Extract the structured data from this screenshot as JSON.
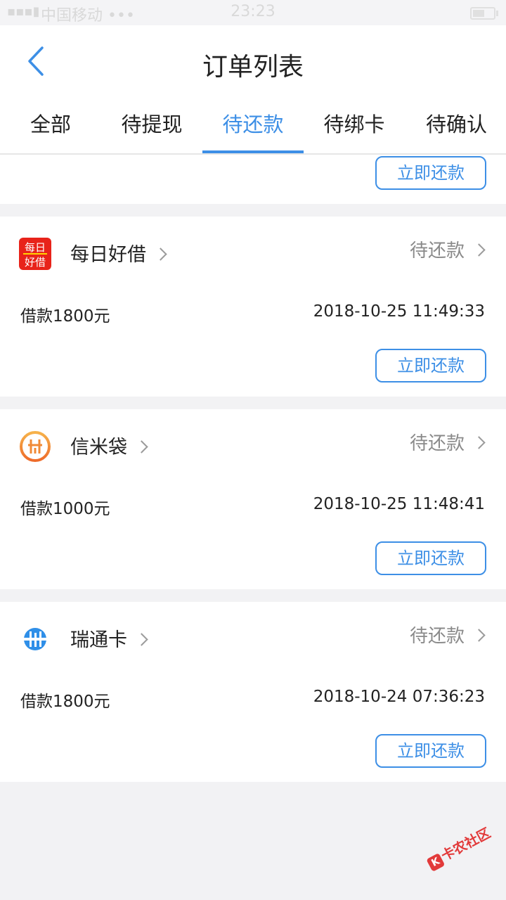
{
  "status_bar": {
    "signal_label": "无SIM",
    "carrier": "中国移动 •••",
    "time": "23:23"
  },
  "nav": {
    "title": "订单列表",
    "back_icon": "chevron-left-icon"
  },
  "tabs": [
    {
      "label": "全部",
      "active": false
    },
    {
      "label": "待提现",
      "active": false
    },
    {
      "label": "待还款",
      "active": true
    },
    {
      "label": "待绑卡",
      "active": false
    },
    {
      "label": "待确认",
      "active": false
    }
  ],
  "accent_color": "#3d8fe6",
  "repay_label": "立即还款",
  "orders": [
    {
      "app_name": "每日好借",
      "logo_text_top": "每日",
      "logo_text_bottom": "好借",
      "status": "待还款",
      "amount": "借款1800元",
      "time": "2018-10-25 11:49:33"
    },
    {
      "app_name": "信米袋",
      "status": "待还款",
      "amount": "借款1000元",
      "time": "2018-10-25 11:48:41"
    },
    {
      "app_name": "瑞通卡",
      "status": "待还款",
      "amount": "借款1800元",
      "time": "2018-10-24 07:36:23"
    }
  ],
  "watermark": "卡农社区"
}
